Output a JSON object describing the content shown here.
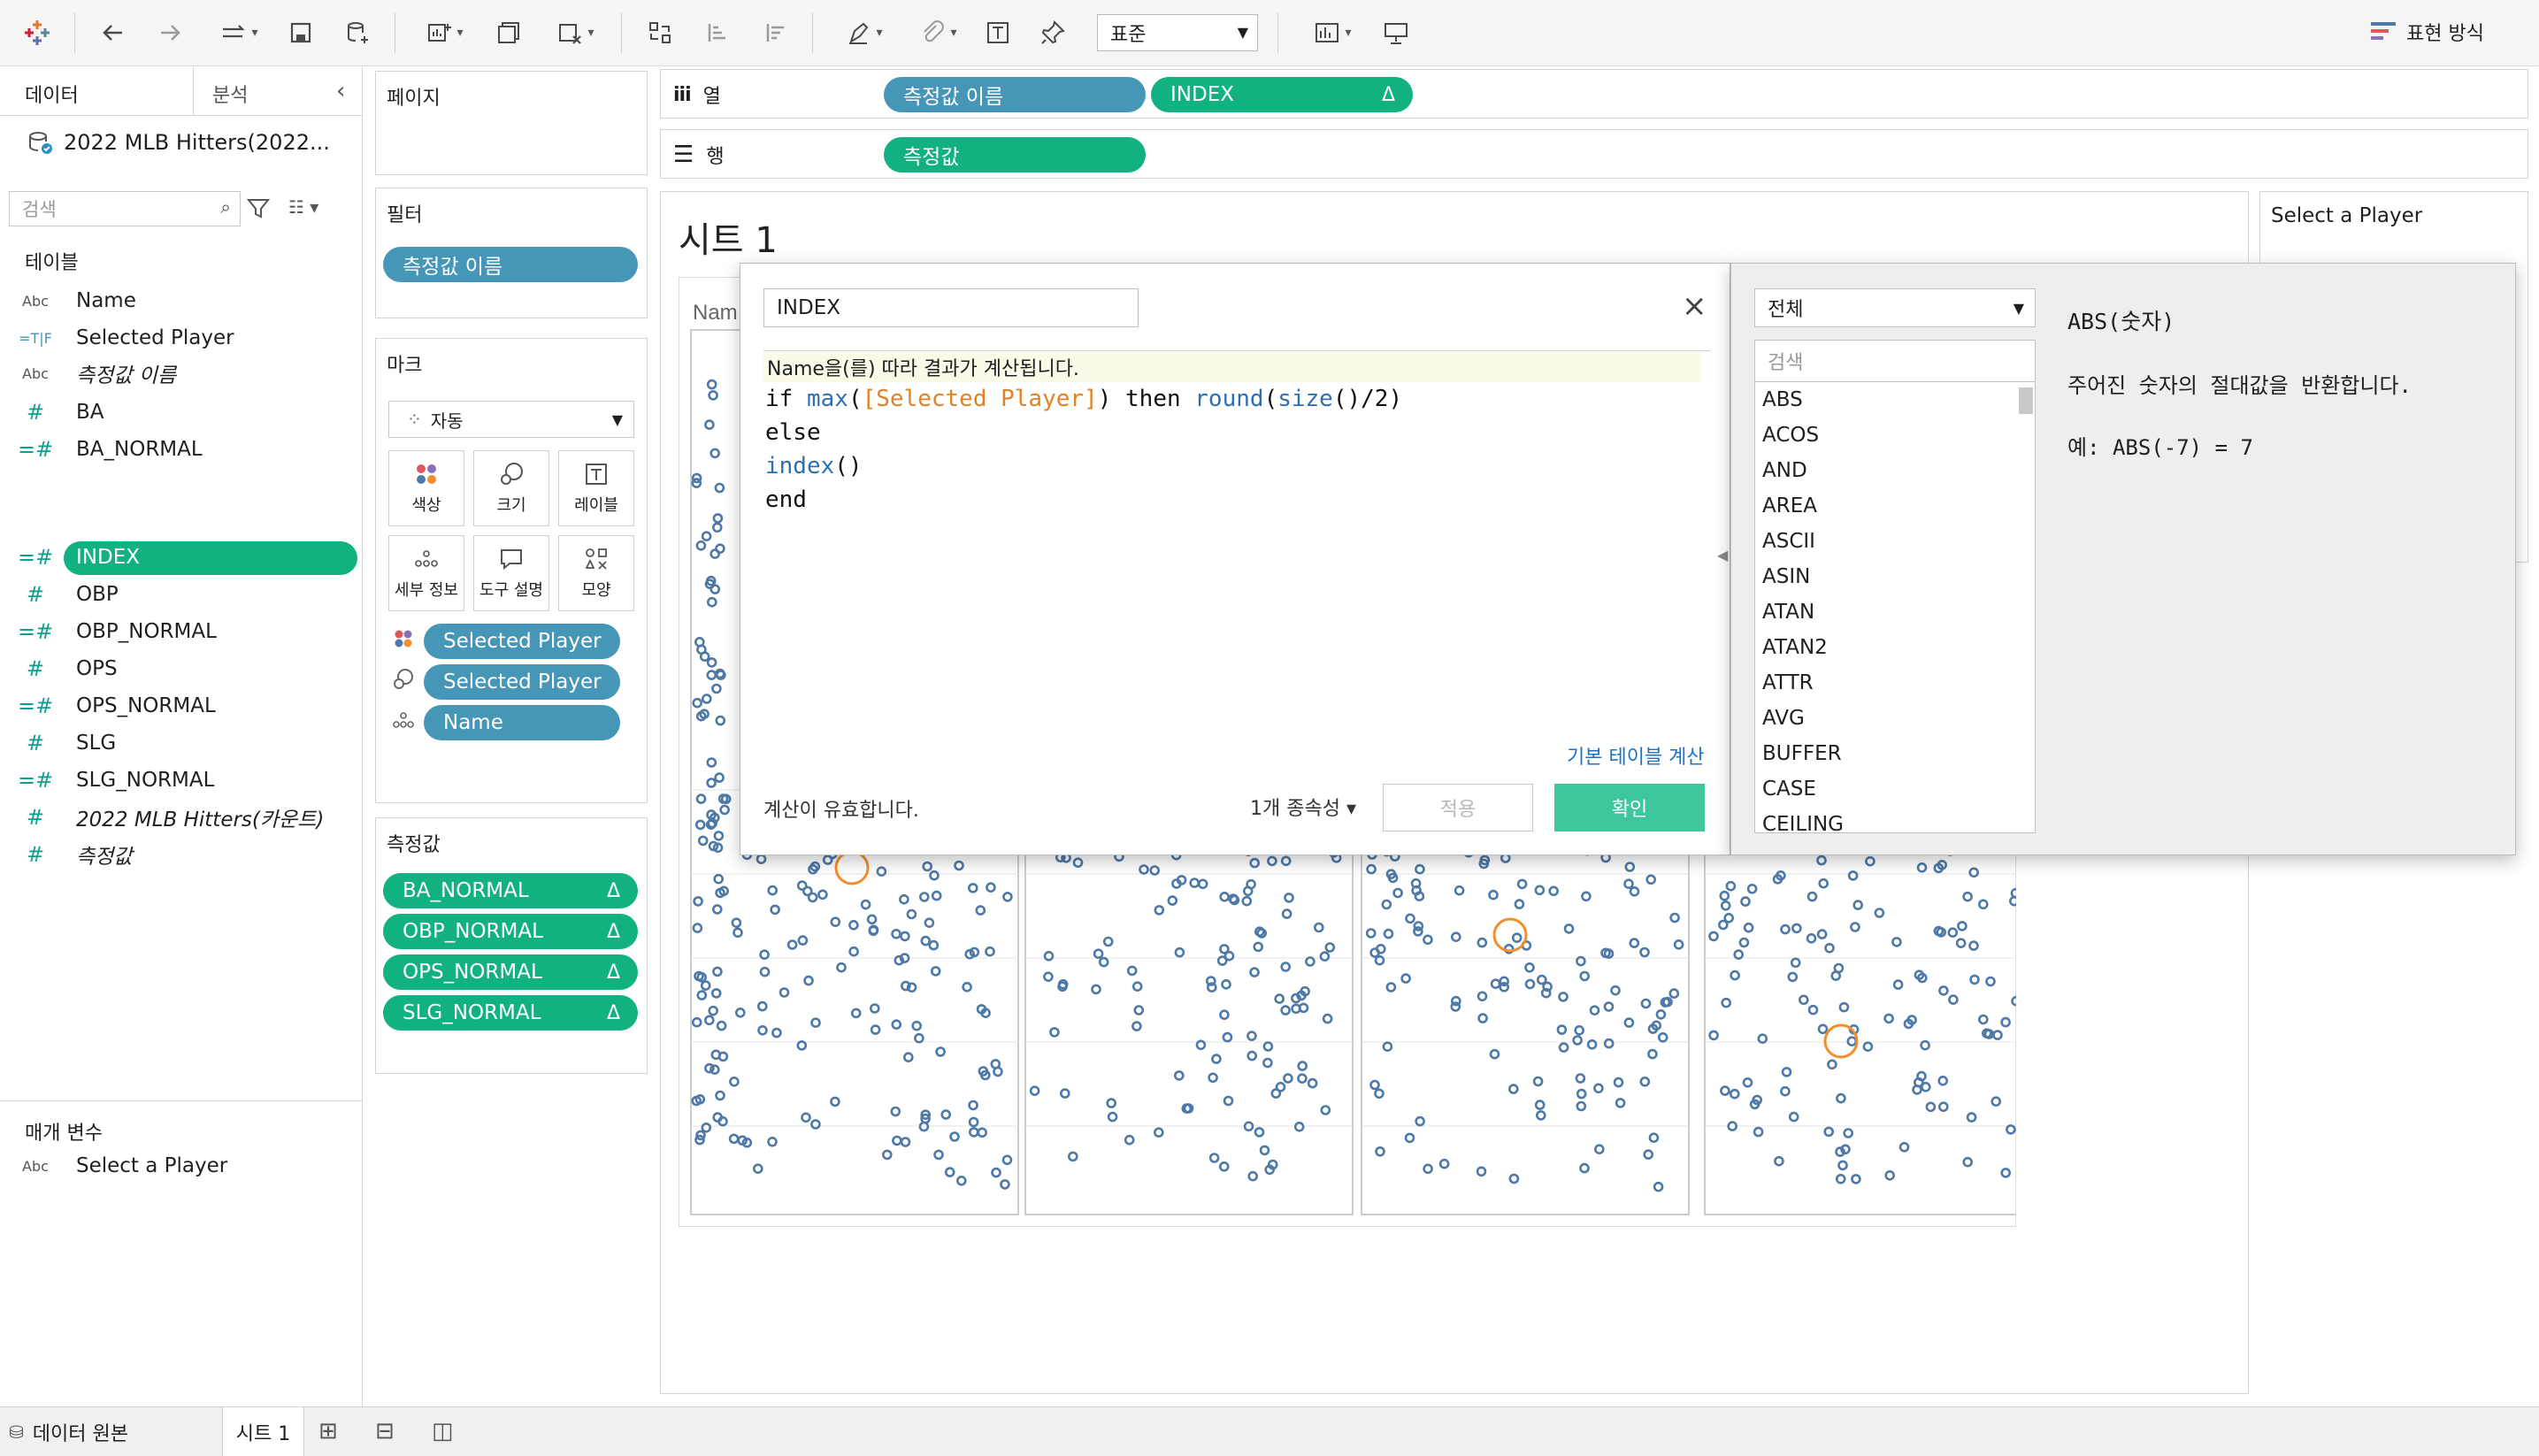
{
  "toolbar": {
    "format_select": "표준",
    "show_me": "표현 방식"
  },
  "datapane": {
    "tab_data": "데이터",
    "tab_analysis": "분석",
    "datasource": "2022 MLB Hitters(2022...",
    "search_placeholder": "검색",
    "tables_header": "테이블",
    "fields": [
      {
        "type": "Abc",
        "name": "Name"
      },
      {
        "type": "=T|F",
        "name": "Selected Player"
      },
      {
        "type": "Abc",
        "name": "측정값 이름"
      },
      {
        "type": "#",
        "name": "BA"
      },
      {
        "type": "=#",
        "name": "BA_NORMAL"
      },
      {
        "type": "=#",
        "name": "INDEX"
      },
      {
        "type": "#",
        "name": "OBP"
      },
      {
        "type": "=#",
        "name": "OBP_NORMAL"
      },
      {
        "type": "#",
        "name": "OPS"
      },
      {
        "type": "=#",
        "name": "OPS_NORMAL"
      },
      {
        "type": "#",
        "name": "SLG"
      },
      {
        "type": "=#",
        "name": "SLG_NORMAL"
      },
      {
        "type": "#",
        "name": "2022 MLB Hitters(카운트)"
      },
      {
        "type": "#",
        "name": "측정값"
      }
    ],
    "params_header": "매개 변수",
    "param": {
      "type": "Abc",
      "name": "Select a Player"
    }
  },
  "cards": {
    "pages_title": "페이지",
    "filters_title": "필터",
    "filter_pill": "측정값 이름",
    "marks_title": "마크",
    "mark_type": "자동",
    "mark_buttons": [
      "색상",
      "크기",
      "레이블",
      "세부 정보",
      "도구 설명",
      "모양"
    ],
    "mark_pills": [
      "Selected Player",
      "Selected Player",
      "Name"
    ],
    "measures_title": "측정값",
    "measure_pills": [
      "BA_NORMAL",
      "OBP_NORMAL",
      "OPS_NORMAL",
      "SLG_NORMAL"
    ],
    "delta": "Δ"
  },
  "shelves": {
    "columns_label": "열",
    "rows_label": "행",
    "col_pill_1": "측정값 이름",
    "col_pill_2": "INDEX",
    "row_pill": "측정값"
  },
  "sheet": {
    "title": "시트 1",
    "header_partial": "Nam",
    "param_card_title": "Select a Player"
  },
  "calc": {
    "name": "INDEX",
    "hint": "Name을(를) 따라 결과가 계산됩니다.",
    "code": {
      "l1_if": "if ",
      "l1_max": "max",
      "l1_open": "(",
      "l1_field": "[Selected Player]",
      "l1_then": ") then ",
      "l1_round": "round",
      "l1_paren": "(",
      "l1_size": "size",
      "l1_rest": "()/2)",
      "l2": "else",
      "l3_fn": "index",
      "l3_rest": "()",
      "l4": "end"
    },
    "table_calc_link": "기본 테이블 계산",
    "valid": "계산이 유효합니다.",
    "dependencies": "1개 종속성 ▾",
    "apply": "적용",
    "ok": "확인"
  },
  "functions": {
    "category": "전체",
    "search_placeholder": "검색",
    "list": [
      "ABS",
      "ACOS",
      "AND",
      "AREA",
      "ASCII",
      "ASIN",
      "ATAN",
      "ATAN2",
      "ATTR",
      "AVG",
      "BUFFER",
      "CASE",
      "CEILING"
    ],
    "doc_title": "ABS(숫자)",
    "doc_desc": "주어진 숫자의 절대값을 반환합니다.",
    "doc_example": "예: ABS(-7) = 7"
  },
  "bottom": {
    "source_tab": "데이터 원본",
    "sheet_tab": "시트 1"
  },
  "colors": {
    "dimension_pill": "#4596b7",
    "measure_pill": "#12b181",
    "mark_dot": "#4e79a7",
    "highlight": "#f28e2b"
  }
}
